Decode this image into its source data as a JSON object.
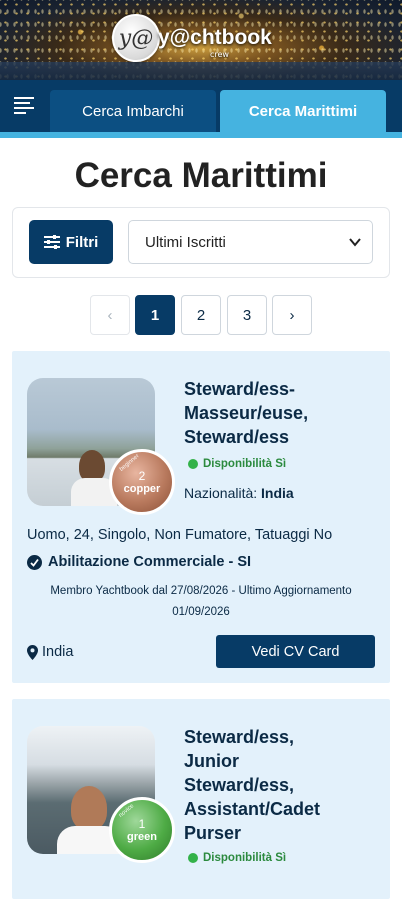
{
  "logo": {
    "mark": "y@",
    "name": "y@chtbook",
    "sub": "crew"
  },
  "nav": {
    "menu_icon": "hamburger-menu-icon",
    "tabs": [
      {
        "label": "Cerca Imbarchi",
        "active": false
      },
      {
        "label": "Cerca Marittimi",
        "active": true
      }
    ]
  },
  "page": {
    "title": "Cerca Marittimi"
  },
  "filters": {
    "button_label": "Filtri",
    "button_icon": "sliders-icon",
    "sort_selected": "Ultimi Iscritti"
  },
  "pagination": {
    "prev": "‹",
    "pages": [
      "1",
      "2",
      "3"
    ],
    "current": "1",
    "next": "›"
  },
  "colors": {
    "primary": "#073b66",
    "accent": "#45b3e0",
    "card_bg": "#e3f1fb",
    "available": "#33b249"
  },
  "cards": [
    {
      "role_lines": [
        "Steward/ess-",
        "Masseur/euse,",
        "Steward/ess"
      ],
      "badge": {
        "number": "2",
        "level": "copper",
        "tiny": "beginner"
      },
      "availability": "Disponibilità Sì",
      "nationality_label": "Nazionalità:",
      "nationality": "India",
      "details": "Uomo, 24, Singolo, Non Fumatore, Tatuaggi No",
      "qualification": "Abilitazione Commerciale - SI",
      "member_line1": "Membro Yachtbook dal 27/08/2026 - Ultimo Aggiornamento",
      "member_line2": "01/09/2026",
      "location": "India",
      "cv_button": "Vedi CV Card"
    },
    {
      "role_lines": [
        "Steward/ess,",
        "Junior",
        "Steward/ess,",
        "Assistant/Cadet",
        "Purser"
      ],
      "badge": {
        "number": "1",
        "level": "green",
        "tiny": "novice"
      },
      "availability": "Disponibilità Sì"
    }
  ]
}
